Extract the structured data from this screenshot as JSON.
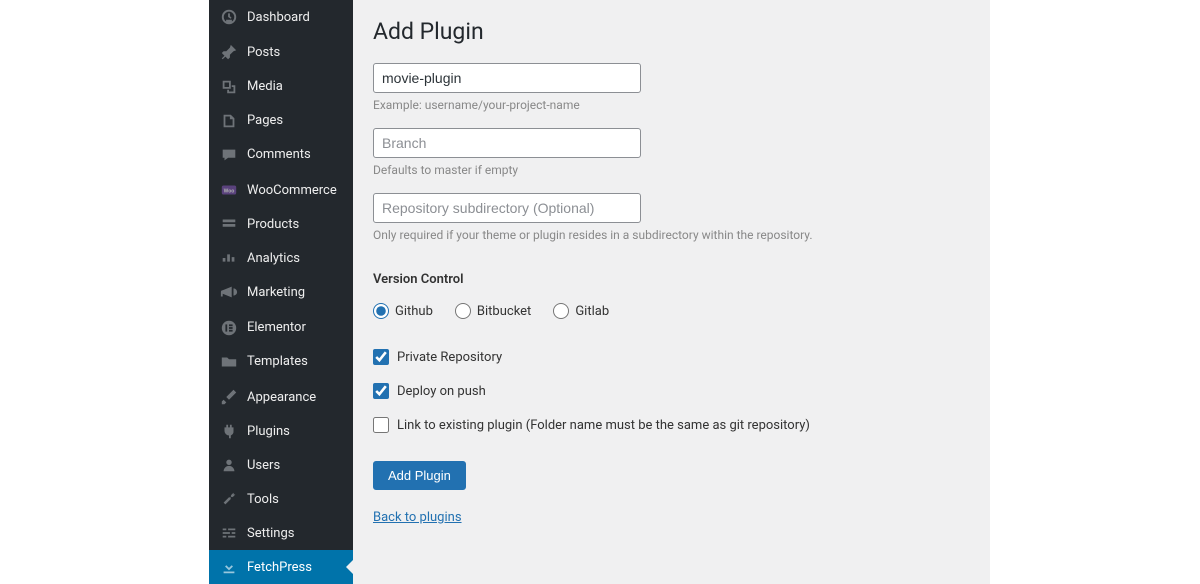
{
  "sidebar": {
    "items": [
      {
        "label": "Dashboard"
      },
      {
        "label": "Posts"
      },
      {
        "label": "Media"
      },
      {
        "label": "Pages"
      },
      {
        "label": "Comments"
      },
      {
        "label": "WooCommerce"
      },
      {
        "label": "Products"
      },
      {
        "label": "Analytics"
      },
      {
        "label": "Marketing"
      },
      {
        "label": "Elementor"
      },
      {
        "label": "Templates"
      },
      {
        "label": "Appearance"
      },
      {
        "label": "Plugins"
      },
      {
        "label": "Users"
      },
      {
        "label": "Tools"
      },
      {
        "label": "Settings"
      },
      {
        "label": "FetchPress"
      }
    ]
  },
  "page": {
    "title": "Add Plugin"
  },
  "form": {
    "repo_value": "movie-plugin",
    "repo_hint": "Example: username/your-project-name",
    "branch_placeholder": "Branch",
    "branch_hint": "Defaults to master if empty",
    "subdir_placeholder": "Repository subdirectory (Optional)",
    "subdir_hint": "Only required if your theme or plugin resides in a subdirectory within the repository.",
    "vc_label": "Version Control",
    "vc_github": "Github",
    "vc_bitbucket": "Bitbucket",
    "vc_gitlab": "Gitlab",
    "chk_private": "Private Repository",
    "chk_deploy": "Deploy on push",
    "chk_link": "Link to existing plugin (Folder name must be the same as git repository)",
    "submit": "Add Plugin",
    "back_link": "Back to plugins"
  }
}
